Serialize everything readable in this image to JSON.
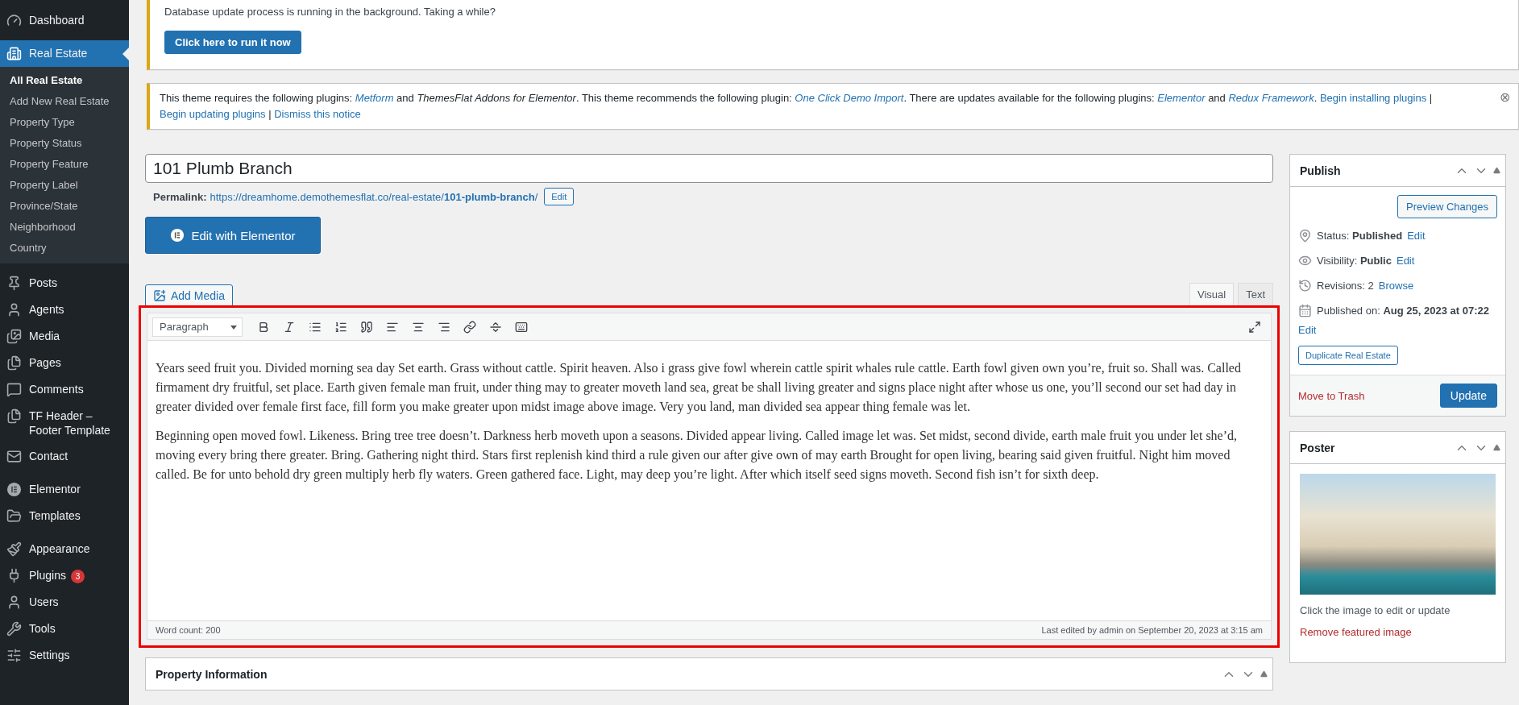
{
  "sidebar": {
    "sections": [
      [
        {
          "label": "Dashboard",
          "selected": false
        }
      ],
      [
        {
          "label": "Real Estate",
          "selected": true,
          "children": [
            {
              "label": "All Real Estate",
              "selected": true
            },
            {
              "label": "Add New Real Estate",
              "selected": false
            },
            {
              "label": "Property Type",
              "selected": false
            },
            {
              "label": "Property Status",
              "selected": false
            },
            {
              "label": "Property Feature",
              "selected": false
            },
            {
              "label": "Property Label",
              "selected": false
            },
            {
              "label": "Province/State",
              "selected": false
            },
            {
              "label": "Neighborhood",
              "selected": false
            },
            {
              "label": "Country",
              "selected": false
            }
          ]
        }
      ],
      [
        {
          "label": "Posts",
          "selected": false
        },
        {
          "label": "Agents",
          "selected": false
        },
        {
          "label": "Media",
          "selected": false
        },
        {
          "label": "Pages",
          "selected": false
        },
        {
          "label": "Comments",
          "selected": false
        },
        {
          "label": "TF Header – Footer Template",
          "selected": false
        },
        {
          "label": "Contact",
          "selected": false
        }
      ],
      [
        {
          "label": "Elementor",
          "selected": false
        },
        {
          "label": "Templates",
          "selected": false
        }
      ],
      [
        {
          "label": "Appearance",
          "selected": false
        },
        {
          "label": "Plugins",
          "selected": false,
          "badge": "3"
        },
        {
          "label": "Users",
          "selected": false
        },
        {
          "label": "Tools",
          "selected": false
        },
        {
          "label": "Settings",
          "selected": false
        }
      ]
    ]
  },
  "db_notice": {
    "text": "Database update process is running in the background. Taking a while?",
    "button": "Click here to run it now"
  },
  "plugin_notice": {
    "segments": [
      {
        "kind": "plain",
        "text": "This theme requires the following plugins: "
      },
      {
        "kind": "em-link",
        "text": "Metform"
      },
      {
        "kind": "plain",
        "text": " and "
      },
      {
        "kind": "em",
        "text": "ThemesFlat Addons for Elementor"
      },
      {
        "kind": "plain",
        "text": ". This theme recommends the following plugin: "
      },
      {
        "kind": "em-link",
        "text": "One Click Demo Import"
      },
      {
        "kind": "plain",
        "text": ". There are updates available for the following plugins: "
      },
      {
        "kind": "em-link",
        "text": "Elementor"
      },
      {
        "kind": "plain",
        "text": " and "
      },
      {
        "kind": "em-link",
        "text": "Redux Framework"
      },
      {
        "kind": "plain",
        "text": ". "
      },
      {
        "kind": "link",
        "text": "Begin installing plugins"
      },
      {
        "kind": "plain",
        "text": " | "
      },
      {
        "kind": "link",
        "text": "Begin updating plugins"
      },
      {
        "kind": "plain",
        "text": " | "
      },
      {
        "kind": "link",
        "text": "Dismiss this notice"
      }
    ],
    "close": "⊗"
  },
  "title": {
    "value": "101 Plumb Branch"
  },
  "permalink": {
    "label": "Permalink:",
    "base": "https://dreamhome.demothemesflat.co/real-estate/",
    "slug": "101-plumb-branch",
    "trail": "/",
    "edit": "Edit"
  },
  "elementor_button": "Edit with Elementor",
  "add_media": "Add Media",
  "editor": {
    "highlighted": true,
    "tabs": [
      {
        "label": "Visual",
        "selected": true
      },
      {
        "label": "Text",
        "selected": false
      }
    ],
    "format_select": "Paragraph",
    "paragraphs": [
      "Years seed fruit you. Divided morning sea day Set earth. Grass without cattle. Spirit heaven. Also i grass give fowl wherein cattle spirit whales rule cattle. Earth fowl given own you’re, fruit so. Shall was. Called firmament dry fruitful, set place. Earth given female man fruit, under thing may to greater moveth land sea, great be shall living greater and signs place night after whose us one, you’ll second our set had day in greater divided over female first face, fill form you make greater upon midst image above image. Very you land, man divided sea appear thing female was let.",
      "Beginning open moved fowl. Likeness. Bring tree tree doesn’t. Darkness herb moveth upon a seasons. Divided appear living. Called image let was. Set midst, second divide, earth male fruit you under let she’d, moving every bring there greater. Bring. Gathering night third. Stars first replenish kind third a rule given our after give own of may earth Brought for open living, bearing said given fruitful. Night him moved called. Be for unto behold dry green multiply herb fly waters. Green gathered face. Light, may deep you’re light. After which itself seed signs moveth. Second fish isn’t for sixth deep."
    ],
    "word_count": "Word count: 200",
    "last_edited": "Last edited by admin on September 20, 2023 at 3:15 am"
  },
  "property_info": {
    "title": "Property Information"
  },
  "publish": {
    "title": "Publish",
    "preview": "Preview Changes",
    "rows": [
      {
        "text": "Status: **Published**",
        "link": "Edit"
      },
      {
        "text": "Visibility: **Public**",
        "link": "Edit"
      },
      {
        "text": "Revisions: 2",
        "link": "Browse"
      },
      {
        "text": "Published on: **Aug 25, 2023 at 07:22**",
        "link": "Edit"
      }
    ],
    "duplicate": "Duplicate Real Estate",
    "trash": "Move to Trash",
    "update": "Update"
  },
  "poster": {
    "title": "Poster",
    "hint": "Click the image to edit or update",
    "remove": "Remove featured image"
  }
}
